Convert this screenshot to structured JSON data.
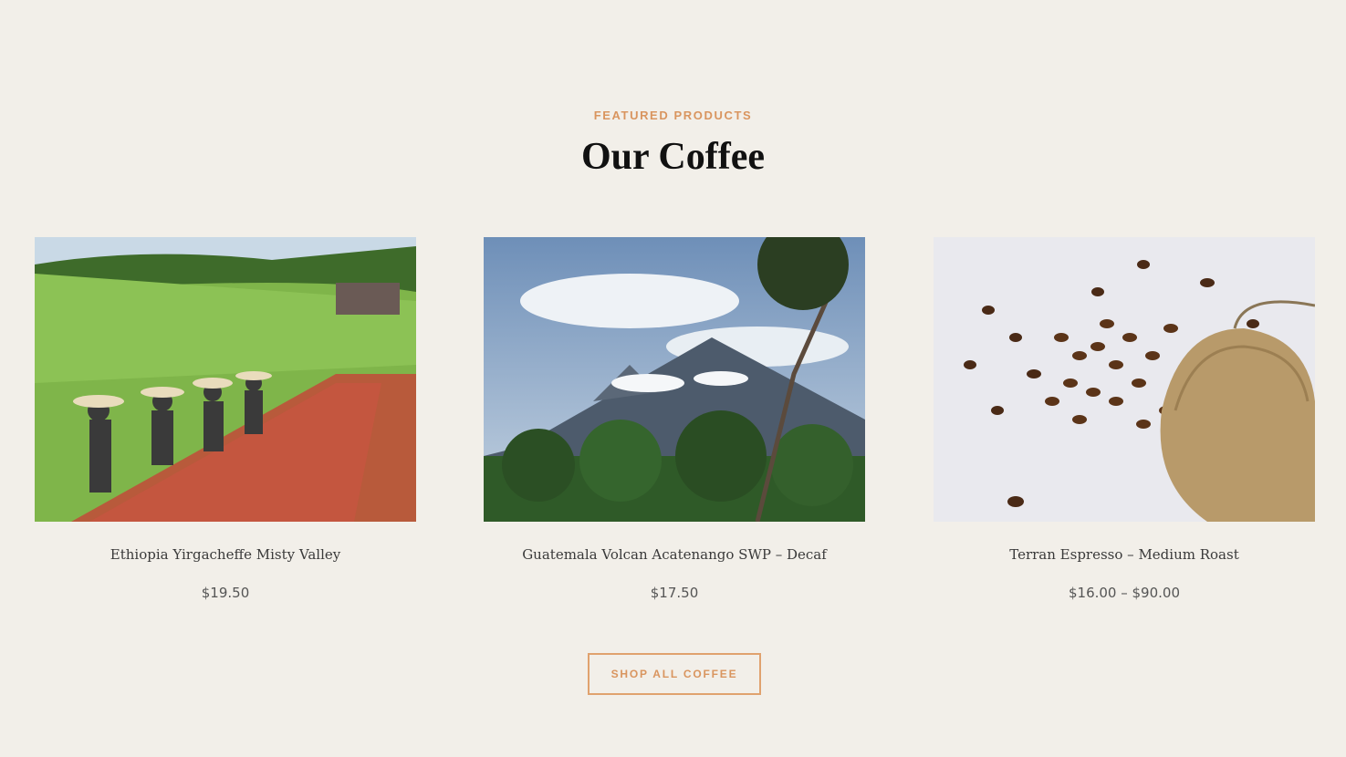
{
  "section": {
    "eyebrow": "FEATURED PRODUCTS",
    "title": "Our Coffee"
  },
  "products": [
    {
      "name": "Ethiopia Yirgacheffe Misty Valley",
      "price": "$19.50"
    },
    {
      "name": "Guatemala Volcan Acatenango SWP – Decaf",
      "price": "$17.50"
    },
    {
      "name": "Terran Espresso – Medium Roast",
      "price": "$16.00 – $90.00"
    }
  ],
  "cta": {
    "label": "SHOP ALL COFFEE"
  },
  "colors": {
    "background": "#f2efe9",
    "accent": "#d9955f",
    "heading": "#111111",
    "text": "#3a3a3a"
  }
}
